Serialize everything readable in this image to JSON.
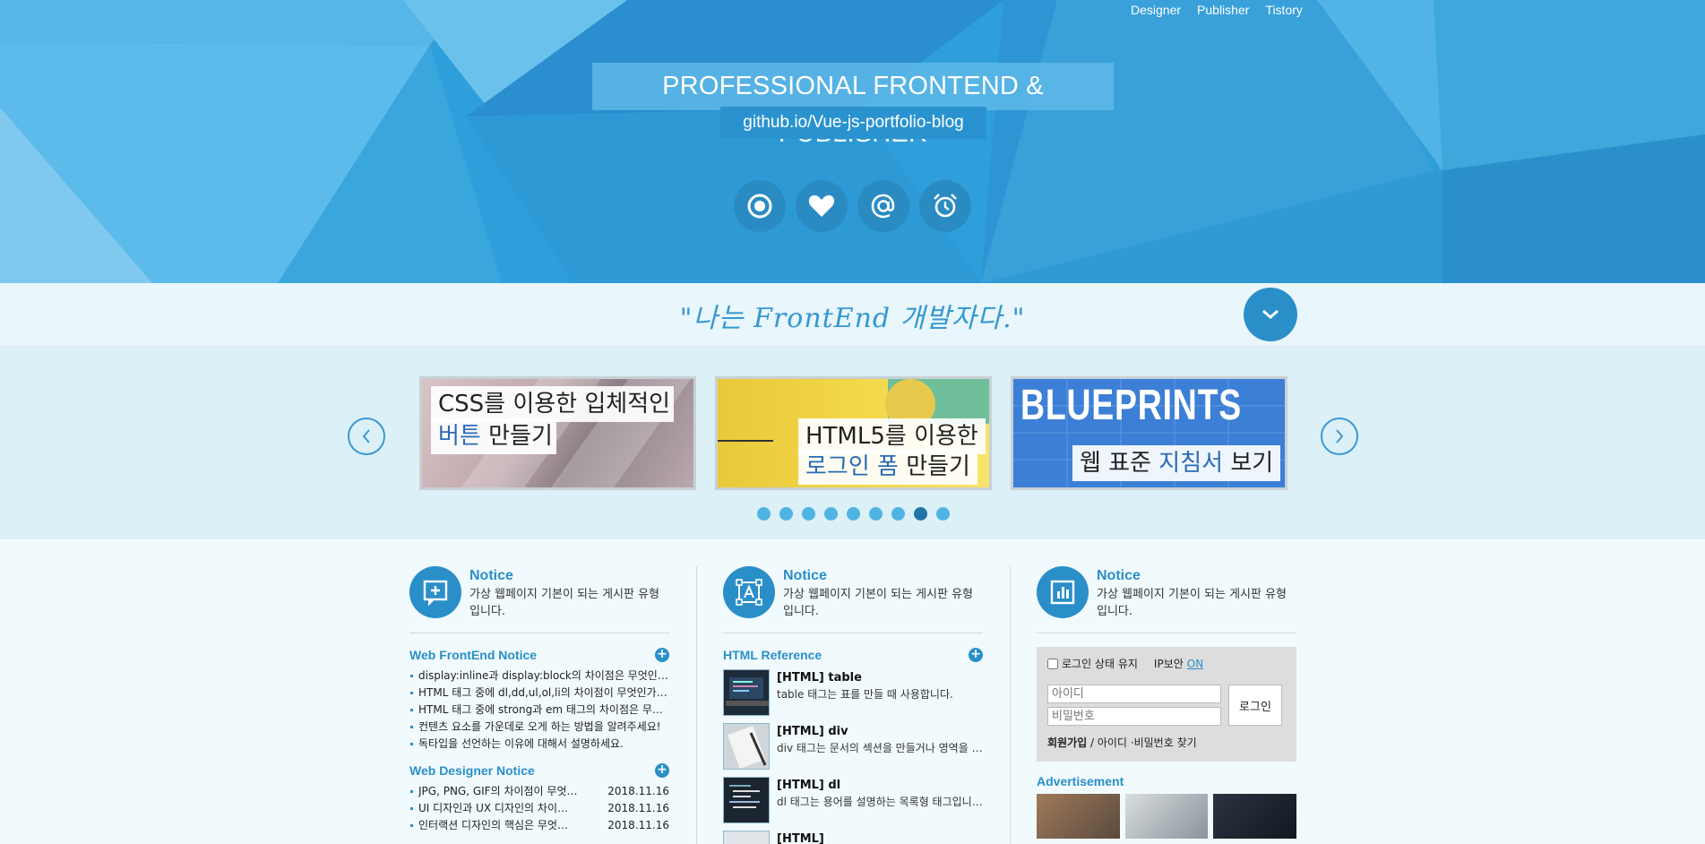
{
  "nav": {
    "items": [
      "Designer",
      "Publisher",
      "Tistory"
    ]
  },
  "hero": {
    "title": "PROFESSIONAL FRONTEND & PUBLISHER",
    "subtitle": "github.io/Vue-js-portfolio-blog",
    "icons": [
      "record-icon",
      "heart-icon",
      "at-sign-icon",
      "alarm-clock-icon"
    ]
  },
  "quote": {
    "text": "\"나는 FrontEnd 개발자다.\""
  },
  "slider": {
    "slides": [
      {
        "line1": "CSS를 이용한 입체적인",
        "line2_highlight": "버튼",
        "line2_rest": " 만들기"
      },
      {
        "line1": "HTML5를 이용한",
        "line2_highlight": "로그인 폼",
        "line2_rest": " 만들기"
      },
      {
        "line1_prefix": "웹 표준 ",
        "line1_highlight": "지침서",
        "line1_rest": " 보기",
        "banner": "BLUEPRINTS"
      }
    ],
    "dot_count": 9,
    "active_dot": 8
  },
  "columns": [
    {
      "head_title": "Notice",
      "head_desc": "가상 웹페이지 기본이 되는 게시판 유형입니다.",
      "sec1_title": "Web FrontEnd Notice",
      "sec1_items": [
        "display:inline과 display:block의 차이점은 무엇인가요?",
        "HTML 태그 중에 dl,dd,ul,ol,li의 차이점이 무엇인가요?",
        "HTML 태그 중에 strong과 em 태그의 차이점은 무엇인가요?",
        "컨텐츠 요소를 가운데로 오게 하는 방법을 알려주세요!",
        "독타입을 선언하는 이유에 대해서 설명하세요."
      ],
      "sec2_title": "Web Designer Notice",
      "sec2_items": [
        {
          "text": "JPG, PNG, GIF의 차이점이 무엇인가요?",
          "date": "2018.11.16"
        },
        {
          "text": "UI 디자인과 UX 디자인의 차이점은?",
          "date": "2018.11.16"
        },
        {
          "text": "인터랙션 디자인의 핵심은 무엇인가요?",
          "date": "2018.11.16"
        }
      ]
    },
    {
      "head_title": "Notice",
      "head_desc": "가상 웹페이지 기본이 되는 게시판 유형입니다.",
      "sec1_title": "HTML Reference",
      "refs": [
        {
          "title": "[HTML] table",
          "desc": "table 태그는 표를 만들 때 사용합니다."
        },
        {
          "title": "[HTML] div",
          "desc": "div 태그는 문서의 섹션을 만들거나 영역을 나눌 때 사용합니다."
        },
        {
          "title": "[HTML] dl",
          "desc": "dl 태그는 용어를 설명하는 목록형 태그입니다."
        },
        {
          "title": "[HTML]",
          "desc": ""
        }
      ]
    },
    {
      "head_title": "Notice",
      "head_desc": "가상 웹페이지 기본이 되는 게시판 유형입니다.",
      "login": {
        "keep_label": "로그인 상태 유지",
        "ip_label": "IP보안",
        "ip_state": "ON",
        "id_placeholder": "아이디",
        "pw_placeholder": "비밀번호",
        "submit": "로그인",
        "join": "회원가입",
        "sep": " / ",
        "find": "아이디 ·비밀번호 찾기"
      },
      "ad_title": "Advertisement"
    }
  ],
  "colors": {
    "accent": "#2a8fc8",
    "hero": "#2e9fda",
    "band": "#e9f6fb",
    "slider_bg": "#dcf0f7"
  }
}
